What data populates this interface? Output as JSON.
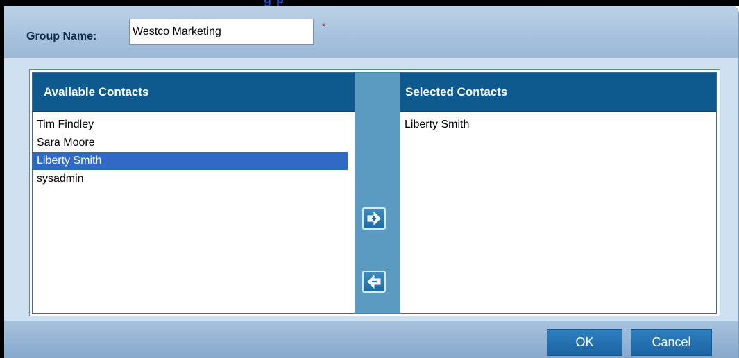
{
  "window": {
    "title_fragment": "g                              p"
  },
  "form": {
    "group_name_label": "Group Name:",
    "group_name_value": "Westco Marketing",
    "required_marker": "*"
  },
  "available": {
    "header": "Available Contacts",
    "items": [
      {
        "label": "Tim Findley",
        "selected": false
      },
      {
        "label": "Sara Moore",
        "selected": false
      },
      {
        "label": "Liberty Smith",
        "selected": true
      },
      {
        "label": "sysadmin",
        "selected": false
      }
    ]
  },
  "selected": {
    "header": "Selected Contacts",
    "items": [
      {
        "label": "Liberty Smith"
      }
    ]
  },
  "shuttle": {
    "add_icon": "arrow-right-plus-icon",
    "remove_icon": "arrow-left-minus-icon"
  },
  "footer": {
    "ok_label": "OK",
    "cancel_label": "Cancel"
  },
  "colors": {
    "header_blue": "#0e5a8f",
    "selection_blue": "#316ac5",
    "middle_column": "#5b9bc2",
    "dialog_background": "#c8dbec",
    "required_red": "#d0261f"
  }
}
